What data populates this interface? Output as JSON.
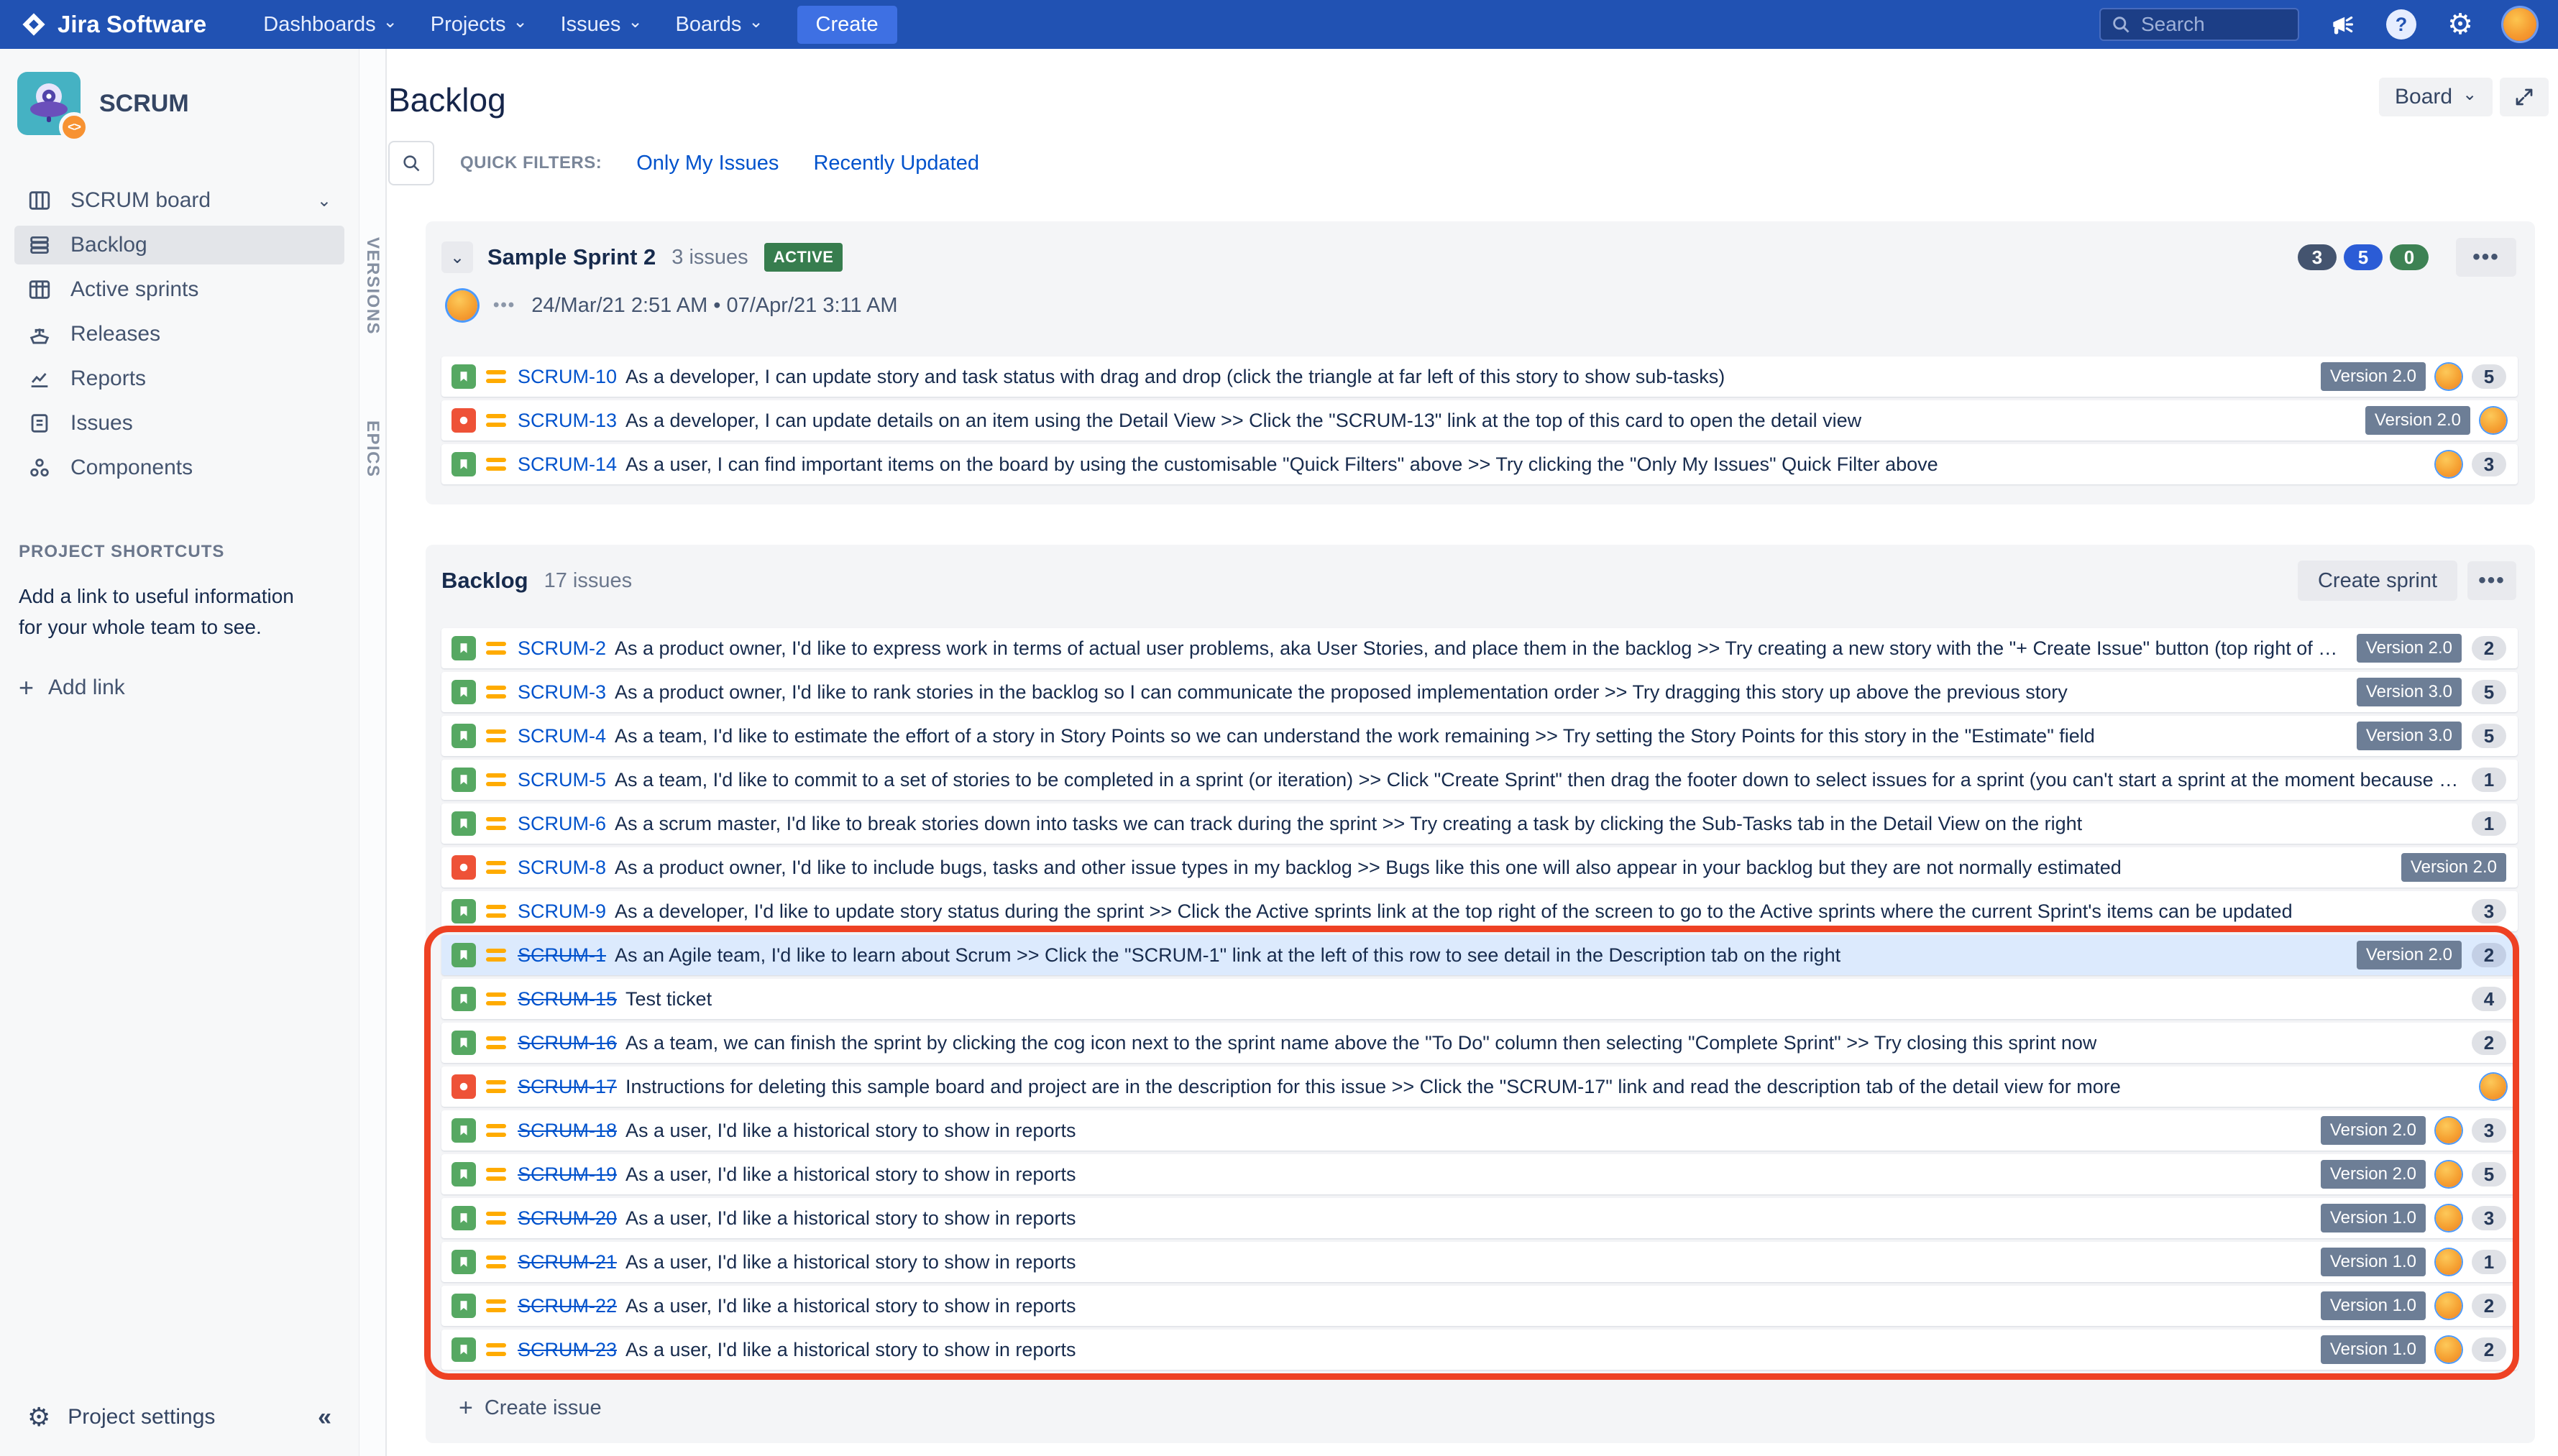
{
  "topnav": {
    "logo": "Jira Software",
    "items": [
      "Dashboards",
      "Projects",
      "Issues",
      "Boards"
    ],
    "create_label": "Create",
    "search_placeholder": "Search"
  },
  "sidebar": {
    "project_name": "SCRUM",
    "board_name": "SCRUM board",
    "items": [
      "Backlog",
      "Active sprints",
      "Releases",
      "Reports",
      "Issues",
      "Components"
    ],
    "shortcuts_title": "PROJECT SHORTCUTS",
    "shortcuts_text": "Add a link to useful information for your whole team to see.",
    "add_link_label": "Add link",
    "project_settings_label": "Project settings"
  },
  "rail": {
    "versions_label": "VERSIONS",
    "epics_label": "EPICS"
  },
  "header": {
    "page_title": "Backlog",
    "board_menu_label": "Board",
    "quick_filters_label": "QUICK FILTERS:",
    "filters": [
      "Only My Issues",
      "Recently Updated"
    ]
  },
  "sprint": {
    "name": "Sample Sprint 2",
    "issue_count": "3 issues",
    "status": "ACTIVE",
    "meta_dots": "•••",
    "dates": "24/Mar/21 2:51 AM • 07/Apr/21 3:11 AM",
    "stats": [
      "3",
      "5",
      "0"
    ],
    "issues": [
      {
        "key": "SCRUM-10",
        "type": "story",
        "summary": "As a developer, I can update story and task status with drag and drop (click the triangle at far left of this story to show sub-tasks)",
        "version": "Version 2.0",
        "avatar": true,
        "estimate": "5"
      },
      {
        "key": "SCRUM-13",
        "type": "bug",
        "summary": "As a developer, I can update details on an item using the Detail View >> Click the \"SCRUM-13\" link at the top of this card to open the detail view",
        "version": "Version 2.0",
        "avatar": true
      },
      {
        "key": "SCRUM-14",
        "type": "story",
        "summary": "As a user, I can find important items on the board by using the customisable \"Quick Filters\" above >> Try clicking the \"Only My Issues\" Quick Filter above",
        "avatar": true,
        "estimate": "3"
      }
    ]
  },
  "backlog": {
    "title": "Backlog",
    "issue_count": "17 issues",
    "create_sprint_label": "Create sprint",
    "create_issue_label": "Create issue",
    "issues": [
      {
        "key": "SCRUM-2",
        "type": "story",
        "summary": "As a product owner, I'd like to express work in terms of actual user problems, aka User Stories, and place them in the backlog >> Try creating a new story with the \"+ Create Issue\" button (top right of screen)",
        "version": "Version 2.0",
        "estimate": "2"
      },
      {
        "key": "SCRUM-3",
        "type": "story",
        "summary": "As a product owner, I'd like to rank stories in the backlog so I can communicate the proposed implementation order >> Try dragging this story up above the previous story",
        "version": "Version 3.0",
        "estimate": "5"
      },
      {
        "key": "SCRUM-4",
        "type": "story",
        "summary": "As a team, I'd like to estimate the effort of a story in Story Points so we can understand the work remaining >> Try setting the Story Points for this story in the \"Estimate\" field",
        "version": "Version 3.0",
        "estimate": "5"
      },
      {
        "key": "SCRUM-5",
        "type": "story",
        "summary": "As a team, I'd like to commit to a set of stories to be completed in a sprint (or iteration) >> Click \"Create Sprint\" then drag the footer down to select issues for a sprint (you can't start a sprint at the moment because one i...",
        "estimate": "1"
      },
      {
        "key": "SCRUM-6",
        "type": "story",
        "summary": "As a scrum master, I'd like to break stories down into tasks we can track during the sprint >> Try creating a task by clicking the Sub-Tasks tab in the Detail View on the right",
        "estimate": "1"
      },
      {
        "key": "SCRUM-8",
        "type": "bug",
        "summary": "As a product owner, I'd like to include bugs, tasks and other issue types in my backlog >> Bugs like this one will also appear in your backlog but they are not normally estimated",
        "version": "Version 2.0"
      },
      {
        "key": "SCRUM-9",
        "type": "story",
        "summary": "As a developer, I'd like to update story status during the sprint >> Click the Active sprints link at the top right of the screen to go to the Active sprints where the current Sprint's items can be updated",
        "estimate": "3"
      },
      {
        "key": "SCRUM-1",
        "type": "story",
        "done": true,
        "highlight": true,
        "summary": "As an Agile team, I'd like to learn about Scrum >> Click the \"SCRUM-1\" link at the left of this row to see detail in the Description tab on the right",
        "version": "Version 2.0",
        "estimate": "2"
      },
      {
        "key": "SCRUM-15",
        "type": "story",
        "done": true,
        "summary": "Test ticket",
        "estimate": "4"
      },
      {
        "key": "SCRUM-16",
        "type": "story",
        "done": true,
        "summary": "As a team, we can finish the sprint by clicking the cog icon next to the sprint name above the \"To Do\" column then selecting \"Complete Sprint\" >> Try closing this sprint now",
        "estimate": "2"
      },
      {
        "key": "SCRUM-17",
        "type": "bug",
        "done": true,
        "summary": "Instructions for deleting this sample board and project are in the description for this issue >> Click the \"SCRUM-17\" link and read the description tab of the detail view for more",
        "avatar": true
      },
      {
        "key": "SCRUM-18",
        "type": "story",
        "done": true,
        "summary": "As a user, I'd like a historical story to show in reports",
        "version": "Version 2.0",
        "avatar": true,
        "estimate": "3"
      },
      {
        "key": "SCRUM-19",
        "type": "story",
        "done": true,
        "summary": "As a user, I'd like a historical story to show in reports",
        "version": "Version 2.0",
        "avatar": true,
        "estimate": "5"
      },
      {
        "key": "SCRUM-20",
        "type": "story",
        "done": true,
        "summary": "As a user, I'd like a historical story to show in reports",
        "version": "Version 1.0",
        "avatar": true,
        "estimate": "3"
      },
      {
        "key": "SCRUM-21",
        "type": "story",
        "done": true,
        "summary": "As a user, I'd like a historical story to show in reports",
        "version": "Version 1.0",
        "avatar": true,
        "estimate": "1"
      },
      {
        "key": "SCRUM-22",
        "type": "story",
        "done": true,
        "summary": "As a user, I'd like a historical story to show in reports",
        "version": "Version 1.0",
        "avatar": true,
        "estimate": "2"
      },
      {
        "key": "SCRUM-23",
        "type": "story",
        "done": true,
        "summary": "As a user, I'd like a historical story to show in reports",
        "version": "Version 1.0",
        "avatar": true,
        "estimate": "2"
      }
    ]
  },
  "colors": {
    "nav_blue": "#2152b3",
    "link_blue": "#0052cc",
    "active_green": "#377d4e",
    "story_green": "#56a862",
    "bug_red": "#ee5237",
    "priority_orange": "#ffab00",
    "stat_navy": "#44546f",
    "stat_blue": "#2b5cd6",
    "stat_green": "#3d8254",
    "annotation_red": "#ee4123"
  }
}
